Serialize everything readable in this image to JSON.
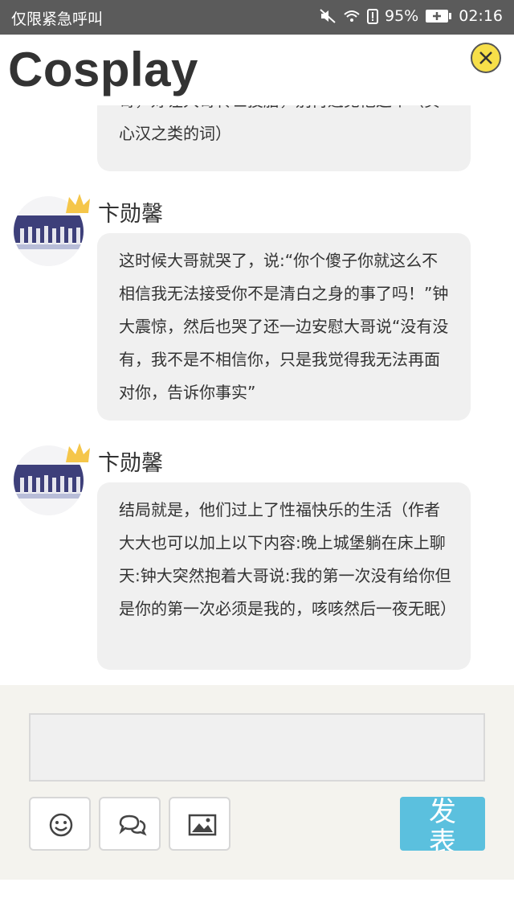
{
  "status_bar": {
    "carrier_text": "仅限紧急呼叫",
    "battery_percent": "95%",
    "time": "02:16",
    "icons": [
      "mute-icon",
      "wifi-icon",
      "battery-alert-icon",
      "battery-icon"
    ]
  },
  "header": {
    "title": "Cosplay",
    "close_icon": "close-icon"
  },
  "messages": [
    {
      "text": "哥，好让大哥转世投胎，别再遇见他这个（负心汉之类的词）",
      "truncated_top": true
    },
    {
      "author": "卞勋馨",
      "badge_icon": "crown-icon",
      "text": "这时候大哥就哭了，说:“你个傻子你就这么不相信我无法接受你不是清白之身的事了吗！”钟大震惊，然后也哭了还一边安慰大哥说“没有没有，我不是不相信你，只是我觉得我无法再面对你，告诉你事实”"
    },
    {
      "author": "卞勋馨",
      "badge_icon": "crown-icon",
      "text": "结局就是，他们过上了性福快乐的生活（作者大大也可以加上以下内容:晚上城堡躺在床上聊天:钟大突然抱着大哥说:我的第一次没有给你但是你的第一次必须是我的，咳咳然后一夜无眠）"
    }
  ],
  "composer": {
    "input_value": "",
    "tools": [
      "emoji-icon",
      "chat-bubbles-icon",
      "image-icon"
    ],
    "send_label": "发表"
  },
  "colors": {
    "status_bar_bg": "#5b5b5b",
    "close_button_bg": "#f7df49",
    "bubble_bg": "#f0f0f0",
    "composer_bg": "#f4f3ee",
    "send_button_bg": "#5bc0de",
    "crown_color": "#f5c64a"
  }
}
